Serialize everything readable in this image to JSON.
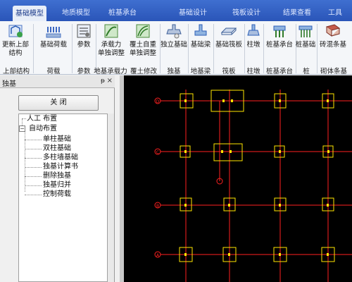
{
  "menu_tabs": [
    {
      "label": "基础模型",
      "active": true
    },
    {
      "label": "地质模型",
      "active": false
    },
    {
      "label": "桩基承台",
      "active": false
    },
    {
      "label": "基础设计",
      "active": false
    },
    {
      "label": "筏板设计",
      "active": false
    },
    {
      "label": "结果查看",
      "active": false
    },
    {
      "label": "工具",
      "active": false
    }
  ],
  "ribbon": {
    "buttons": [
      {
        "label1": "更新上部",
        "label2": "结构",
        "icon": "refresh-structure-icon"
      },
      {
        "label1": "基础荷载",
        "label2": "",
        "icon": "foundation-load-icon"
      },
      {
        "label1": "参数",
        "label2": "",
        "icon": "parameters-icon"
      },
      {
        "label1": "承载力",
        "label2": "单独调整",
        "icon": "bearing-capacity-icon"
      },
      {
        "label1": "覆土自重",
        "label2": "单独调整",
        "icon": "soil-weight-icon"
      },
      {
        "label1": "独立基础",
        "label2": "",
        "icon": "isolated-footing-icon"
      },
      {
        "label1": "基础梁",
        "label2": "",
        "icon": "foundation-beam-icon"
      },
      {
        "label1": "基础筏板",
        "label2": "",
        "icon": "raft-slab-icon"
      },
      {
        "label1": "柱墩",
        "label2": "",
        "icon": "column-pier-icon"
      },
      {
        "label1": "桩基承台",
        "label2": "",
        "icon": "pile-cap-icon"
      },
      {
        "label1": "桩基础",
        "label2": "",
        "icon": "pile-foundation-icon"
      },
      {
        "label1": "砖混条基",
        "label2": "",
        "icon": "masonry-strip-icon"
      }
    ],
    "groups": [
      "上部结构",
      "荷载",
      "参数",
      "地基承载力",
      "覆土修改",
      "独基",
      "地基梁",
      "筏板",
      "柱墩",
      "桩基承台",
      "桩",
      "砌体条基"
    ]
  },
  "left_panel": {
    "title": "独基",
    "pin": "ᵽ",
    "close_x": "×",
    "close_button": "关  闭",
    "tree": {
      "manual": "人工 布置",
      "auto": "自动布置",
      "children": [
        "单柱基础",
        "双柱基础",
        "多柱墙基础",
        "独基计算书",
        "删除独基",
        "独基归并",
        "控制荷载"
      ]
    }
  },
  "canvas": {
    "axis_labels": [
      "D",
      "C",
      "B",
      "A"
    ],
    "colors": {
      "grid": "#ff2020",
      "footing": "#ffe600",
      "label_bg": "#000000"
    }
  }
}
